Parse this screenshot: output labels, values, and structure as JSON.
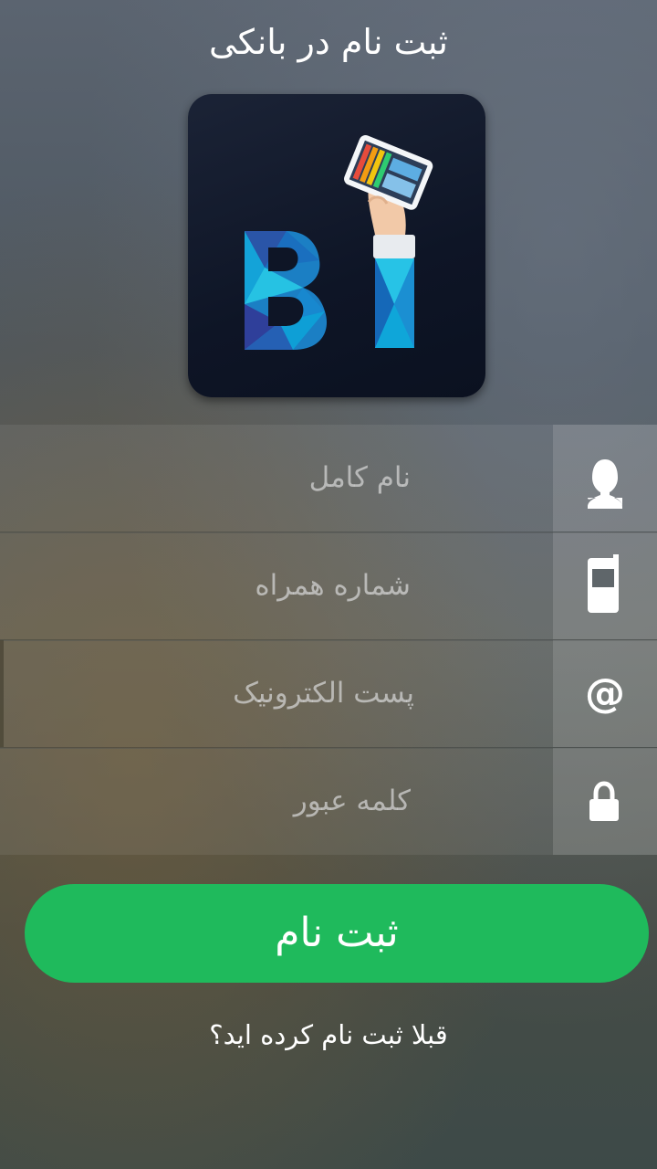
{
  "header": {
    "title": "ثبت نام در بانکی"
  },
  "logo": {
    "name": "BI-logo",
    "letters": "BI"
  },
  "form": {
    "fields": [
      {
        "label": "نام کامل",
        "icon": "user-icon"
      },
      {
        "label": "شماره همراه",
        "icon": "mobile-phone-icon"
      },
      {
        "label": "پست الکترونیک",
        "icon": "at-sign-icon"
      },
      {
        "label": "کلمه عبور",
        "icon": "lock-icon"
      }
    ]
  },
  "actions": {
    "submit_label": "ثبت نام",
    "login_link": "قبلا ثبت نام کرده اید؟"
  },
  "colors": {
    "accent": "#1fba5c",
    "logo_background": "#0e1526",
    "logo_blue": "#1d8fd4"
  }
}
